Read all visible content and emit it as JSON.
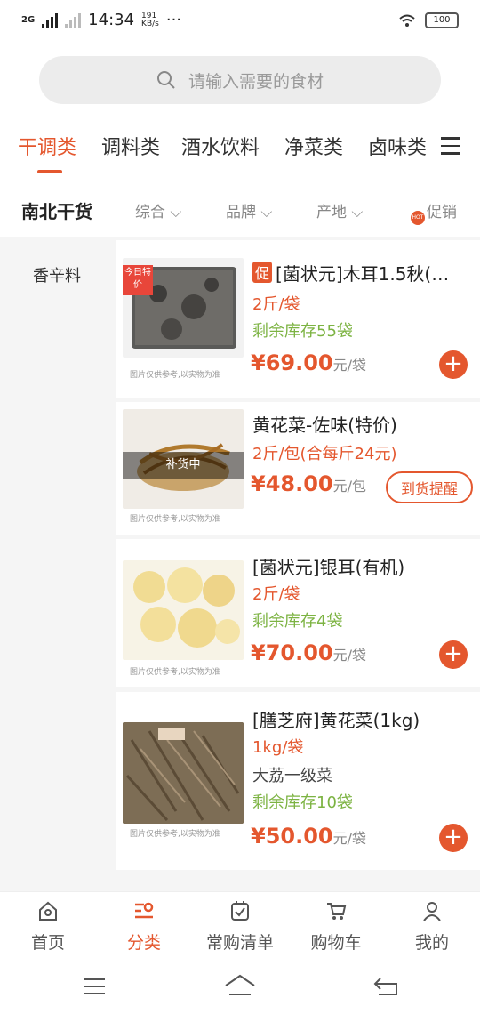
{
  "status": {
    "network": "2G",
    "time": "14:34",
    "speed_value": "191",
    "speed_unit": "KB/s",
    "more": "···",
    "battery": "100"
  },
  "search": {
    "placeholder": "请输入需要的食材"
  },
  "categories": [
    {
      "label": "干调类",
      "active": true
    },
    {
      "label": "调料类"
    },
    {
      "label": "酒水饮料"
    },
    {
      "label": "净菜类"
    },
    {
      "label": "卤味类"
    }
  ],
  "filter": {
    "title": "南北干货",
    "items": [
      "综合",
      "品牌",
      "产地",
      "促销"
    ],
    "hot_badge": "HOT"
  },
  "sidebar": {
    "items": [
      "香辛料"
    ]
  },
  "products": [
    {
      "promo_tag": "促",
      "title": "[菌状元]木耳1.5秋(…",
      "spec": "2斤/袋",
      "stock": "剩余库存55袋",
      "price": "¥69.00",
      "unit": "元/袋",
      "image_badge": "今日特价",
      "image_note": "图片仅供参考,以实物为准",
      "action": "+"
    },
    {
      "title": "黄花菜-佐味(特价)",
      "spec": "2斤/包(合每斤24元)",
      "price": "¥48.00",
      "unit": "元/包",
      "image_overlay": "补货中",
      "image_note": "图片仅供参考,以实物为准",
      "action": "到货提醒"
    },
    {
      "title": "[菌状元]银耳(有机)",
      "spec": "2斤/袋",
      "stock": "剩余库存4袋",
      "price": "¥70.00",
      "unit": "元/袋",
      "image_note": "图片仅供参考,以实物为准",
      "action": "+"
    },
    {
      "title": "[膳芝府]黄花菜(1kg)",
      "spec": "1kg/袋",
      "note": "大荔一级菜",
      "stock": "剩余库存10袋",
      "price": "¥50.00",
      "unit": "元/袋",
      "image_note": "图片仅供参考,以实物为准",
      "action": "+"
    }
  ],
  "tabs": [
    {
      "label": "首页",
      "icon": "home-icon"
    },
    {
      "label": "分类",
      "icon": "category-search-icon",
      "active": true
    },
    {
      "label": "常购清单",
      "icon": "checklist-icon"
    },
    {
      "label": "购物车",
      "icon": "cart-icon"
    },
    {
      "label": "我的",
      "icon": "user-icon"
    }
  ],
  "colors": {
    "accent": "#e4572e",
    "stock": "#7cb342",
    "background": "#f5f5f5"
  }
}
